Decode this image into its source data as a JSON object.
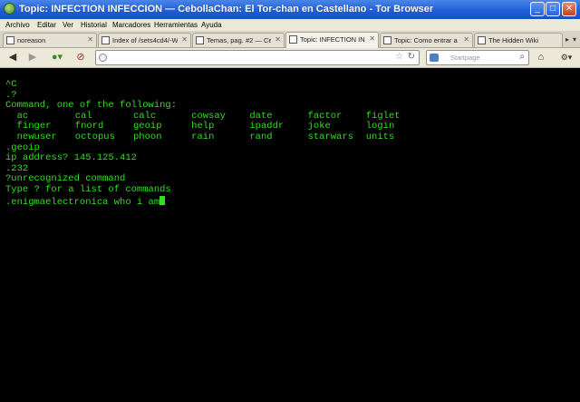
{
  "window": {
    "title": "Topic: INFECTION INFECCION — CebollaChan: El Tor-chan en Castellano - Tor Browser",
    "buttons": [
      "minimize",
      "maximize",
      "close"
    ]
  },
  "menu": [
    "Archivo",
    "Editar",
    "Ver",
    "Historial",
    "Marcadores",
    "Herramientas",
    "Ayuda"
  ],
  "tabs": [
    {
      "label": "noreason",
      "active": false
    },
    {
      "label": "Index of /sets4cd4/-W...",
      "active": false
    },
    {
      "label": "Temas, pag. #2 — Ce...",
      "active": false
    },
    {
      "label": "Topic: INFECTION INF...",
      "active": true
    },
    {
      "label": "Topic: Como entrar a f...",
      "active": false
    },
    {
      "label": "The Hidden Wiki",
      "active": false
    }
  ],
  "navbar": {
    "url": "",
    "search_placeholder": "Startpage"
  },
  "terminal": {
    "lines_before": [
      "^C",
      ".?",
      "Command, one of the following:"
    ],
    "commands": [
      [
        "ac",
        "cal",
        "calc",
        "cowsay",
        "date",
        "factor",
        "figlet"
      ],
      [
        "finger",
        "fnord",
        "geoip",
        "help",
        "ipaddr",
        "joke",
        "login"
      ],
      [
        "newuser",
        "octopus",
        "phoon",
        "rain",
        "rand",
        "starwars",
        "units"
      ]
    ],
    "lines_after": [
      ".geoip",
      "ip address? 145.125.412",
      ".232",
      "?unrecognized command",
      "Type ? for a list of commands"
    ],
    "prompt": ".enigmaelectronica who i am"
  }
}
